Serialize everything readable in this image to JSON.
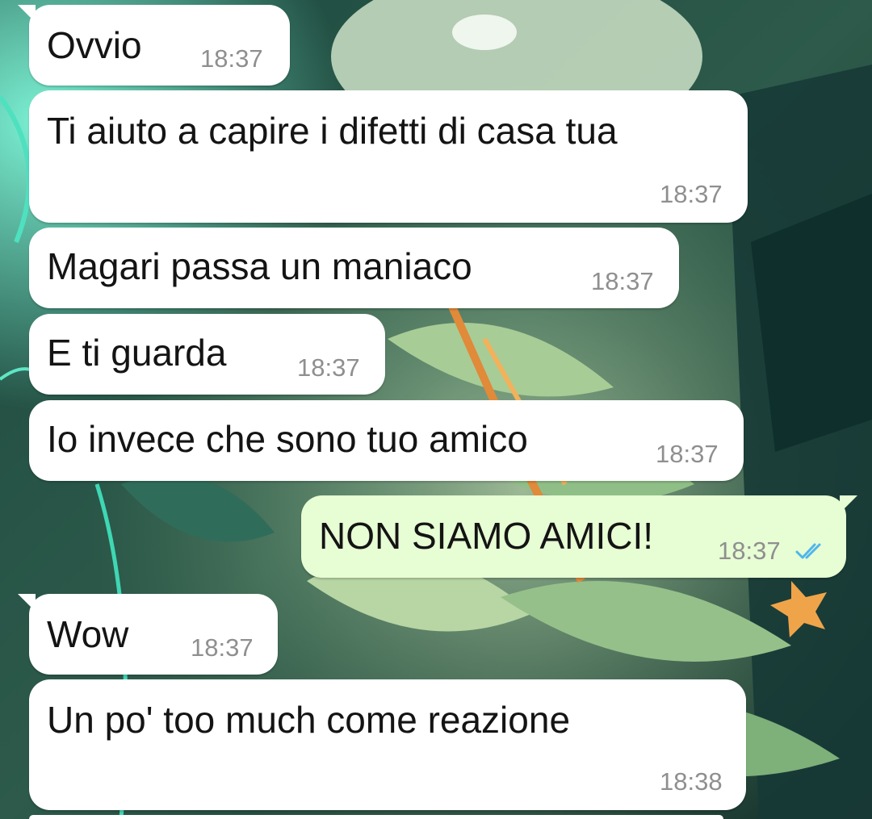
{
  "wallpaper": {
    "description_icon": "wallpaper-illustration",
    "colors": [
      "#1d3a33",
      "#3f7a5e",
      "#8fc49a",
      "#cfe7c8",
      "#e08a3a"
    ]
  },
  "colors": {
    "incoming_bubble": "#ffffff",
    "outgoing_bubble": "#e7fdd4",
    "timestamp": "#8f8f8f",
    "read_ticks": "#4fb6ec"
  },
  "messages": [
    {
      "direction": "in",
      "text": "Ovvio",
      "time": "18:37"
    },
    {
      "direction": "in",
      "text": "Ti aiuto a capire i difetti di casa tua",
      "time": "18:37"
    },
    {
      "direction": "in",
      "text": "Magari passa un maniaco",
      "time": "18:37"
    },
    {
      "direction": "in",
      "text": "E ti guarda",
      "time": "18:37"
    },
    {
      "direction": "in",
      "text": "Io invece che sono tuo amico",
      "time": "18:37"
    },
    {
      "direction": "out",
      "text": "NON SIAMO AMICI!",
      "time": "18:37",
      "status_icon": "double-check-read-icon"
    },
    {
      "direction": "in",
      "text": "Wow",
      "time": "18:37"
    },
    {
      "direction": "in",
      "text": "Un po' too much come reazione",
      "time": "18:38"
    }
  ]
}
